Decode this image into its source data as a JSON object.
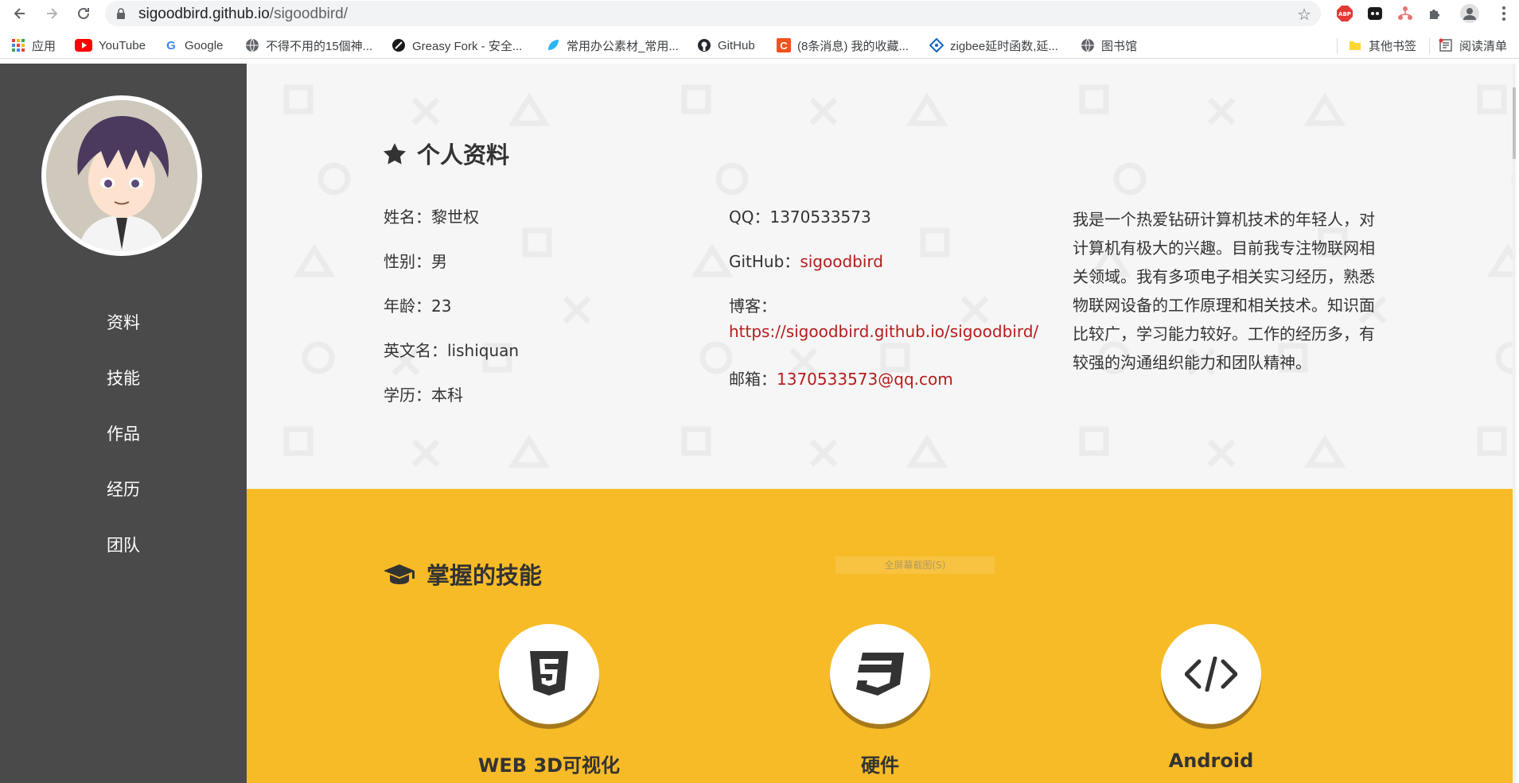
{
  "browser": {
    "url_host": "sigoodbird.github.io",
    "url_path": "/sigoodbird/",
    "extensions": [
      "abp-icon",
      "ghost-icon",
      "network-icon",
      "puzzle-icon",
      "profile-icon"
    ],
    "bookmarks": [
      {
        "label": "应用",
        "icon": "apps-icon"
      },
      {
        "label": "YouTube",
        "icon": "youtube-icon"
      },
      {
        "label": "Google",
        "icon": "google-icon"
      },
      {
        "label": "不得不用的15個神...",
        "icon": "globe-icon"
      },
      {
        "label": "Greasy Fork - 安全...",
        "icon": "greasyfork-icon"
      },
      {
        "label": "常用办公素材_常用...",
        "icon": "leaf-icon"
      },
      {
        "label": "GitHub",
        "icon": "github-icon"
      },
      {
        "label": "(8条消息) 我的收藏...",
        "icon": "csdn-icon"
      },
      {
        "label": "zigbee延时函数,延...",
        "icon": "diamond-icon"
      },
      {
        "label": "图书馆",
        "icon": "globe-icon"
      }
    ],
    "other_bookmarks": "其他书签",
    "reading_list": "阅读清单",
    "colors": {
      "omnibox": "#f1f3f4",
      "abp": "#e53935",
      "csdn": "#f4511e"
    }
  },
  "sidebar": {
    "items": [
      "资料",
      "技能",
      "作品",
      "经历",
      "团队"
    ],
    "bg_color": "#4a4a4a"
  },
  "profile": {
    "title": "个人资料",
    "icon": "star-icon",
    "name": {
      "label": "姓名：",
      "value": "黎世权"
    },
    "gender": {
      "label": "性别：",
      "value": "男"
    },
    "age": {
      "label": "年龄：",
      "value": "23"
    },
    "english_name": {
      "label": "英文名：",
      "value": "lishiquan"
    },
    "education": {
      "label": "学历：",
      "value": "本科"
    },
    "qq": {
      "label": "QQ：",
      "value": "1370533573"
    },
    "github": {
      "label": "GitHub：",
      "value": "sigoodbird"
    },
    "blog": {
      "label": "博客：",
      "value": "https://sigoodbird.github.io/sigoodbird/"
    },
    "email": {
      "label": "邮箱：",
      "value": "1370533573@qq.com"
    },
    "bio_lines": [
      "我是一个热爱钻研计算机技术的年轻人，对",
      "计算机有极大的兴趣。目前我专注物联网相",
      "关领域。我有多项电子相关实习经历，熟悉",
      "物联网设备的工作原理和相关技术。知识面",
      "比较广，学习能力较好。工作的经历多，有",
      "较强的沟通组织能力和团队精神。"
    ],
    "link_color": "#b71c1c"
  },
  "skills": {
    "title": "掌握的技能",
    "icon": "graduation-cap-icon",
    "items": [
      {
        "name": "WEB 3D可视化",
        "icon": "html5-icon"
      },
      {
        "name": "硬件",
        "icon": "css3-icon"
      },
      {
        "name": "Android",
        "icon": "code-icon"
      }
    ],
    "bg_color": "#f7bb27"
  },
  "tooltip": "全屏幕截图(S)"
}
